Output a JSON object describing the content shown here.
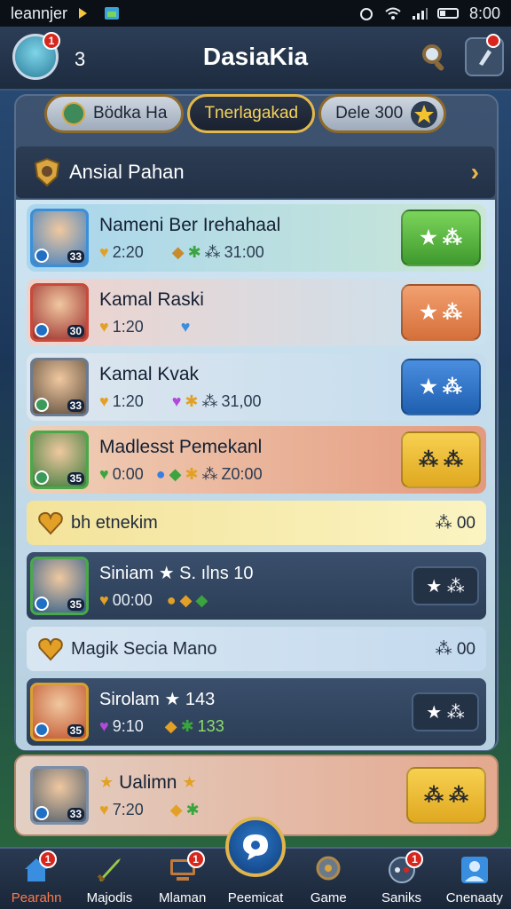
{
  "status_bar": {
    "carrier": "leannjer",
    "time": "8:00"
  },
  "app_bar": {
    "notification_badge": "1",
    "count": "3",
    "title": "DasiaKia"
  },
  "tabs": [
    {
      "label": "Bödka Ha",
      "active": false
    },
    {
      "label": "Tnerlagakad",
      "active": true
    },
    {
      "label": "Dele 300",
      "active": false
    }
  ],
  "section_header": {
    "title": "Ansial Pahan"
  },
  "rows": [
    {
      "name": "Nameni Ber Irehahaal",
      "level": "33",
      "stat1": "2:20",
      "stat2": "31:00",
      "button": "★ ⁂"
    },
    {
      "name": "Kamal Raski",
      "level": "30",
      "stat1": "1:20",
      "stat2": "",
      "button": "★ ⁂"
    },
    {
      "name": "Kamal Kvak",
      "level": "33",
      "stat1": "1:20",
      "stat2": "31,00",
      "button": "★ ⁂"
    },
    {
      "name": "Madlesst Pemekanl",
      "level": "35",
      "stat1": "0:00",
      "stat2": "Z0:00",
      "button": "⁂ ⁂"
    }
  ],
  "banner1": {
    "label": "bh etnekim",
    "value": "⁂ 00"
  },
  "dark_row1": {
    "name": "Siniam ★ S. ılns 10",
    "level": "35",
    "stat1": "00:00",
    "button": "★ ⁂"
  },
  "banner2": {
    "label": "Magik Secia Mano",
    "value": "⁂ 00"
  },
  "dark_row2": {
    "name": "Sirolam ★ 143",
    "level": "35",
    "stat1": "9:10",
    "stat2": "133",
    "button": "★ ⁂"
  },
  "last_row": {
    "name": "Ualimn",
    "level": "33",
    "stat1": "7:20",
    "button": "⁂ ⁂"
  },
  "bottom_nav": [
    {
      "label": "Pearahn",
      "badge": "1",
      "active": true
    },
    {
      "label": "Majodis",
      "badge": "",
      "active": false
    },
    {
      "label": "Mlaman",
      "badge": "1",
      "active": false
    },
    {
      "label": "Peemicat",
      "badge": "",
      "active": false
    },
    {
      "label": "Game",
      "badge": "",
      "active": false
    },
    {
      "label": "Saniks",
      "badge": "1",
      "active": false
    },
    {
      "label": "Cnenaaty",
      "badge": "",
      "active": false
    }
  ],
  "colors": {
    "green_button": "#5bb83e",
    "orange_button": "#e88a4b",
    "blue_button": "#2f74c8",
    "yellow_button": "#f1bf2b",
    "gold_accent": "#e3b94b"
  }
}
